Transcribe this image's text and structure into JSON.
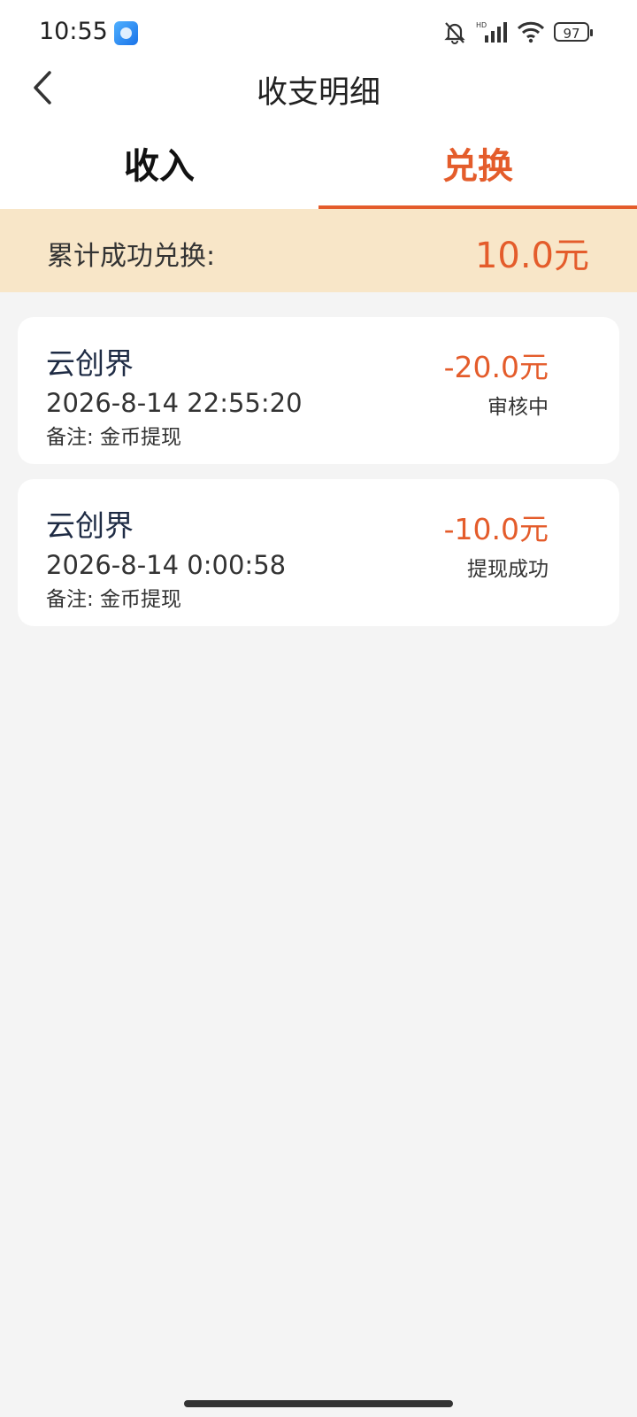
{
  "status_bar": {
    "time": "10:55",
    "battery": "97"
  },
  "nav": {
    "title": "收支明细"
  },
  "tabs": [
    {
      "label": "收入",
      "active": false
    },
    {
      "label": "兑换",
      "active": true
    }
  ],
  "summary": {
    "label": "累计成功兑换:",
    "value": "10.0元"
  },
  "records": [
    {
      "name": "云创界",
      "time": "2026-8-14 22:55:20",
      "note": "备注: 金币提现",
      "amount": "-20.0元",
      "status": "审核中"
    },
    {
      "name": "云创界",
      "time": "2026-8-14 0:00:58",
      "note": "备注: 金币提现",
      "amount": "-10.0元",
      "status": "提现成功"
    }
  ],
  "colors": {
    "accent": "#e45c2b",
    "banner": "#f8e6c8",
    "background": "#f4f4f4"
  }
}
